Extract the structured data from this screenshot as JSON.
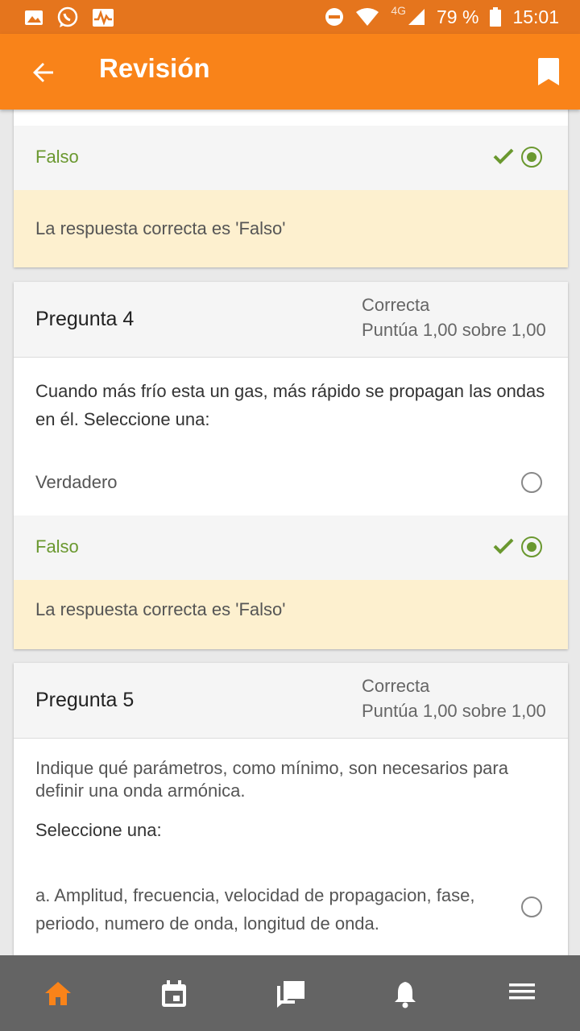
{
  "status_bar": {
    "network": "4G",
    "battery": "79 %",
    "time": "15:01",
    "left_icons": [
      "gallery-icon",
      "whatsapp-icon",
      "pulse-icon"
    ],
    "right_icons": [
      "do-not-disturb-icon",
      "wifi-icon",
      "signal-icon",
      "battery-icon"
    ]
  },
  "app_bar": {
    "title": "Revisión",
    "back_icon": "arrow-left-icon",
    "bookmark_icon": "bookmark-icon"
  },
  "question3_tail": {
    "selected_option": "Falso",
    "feedback": "La respuesta correcta es 'Falso'"
  },
  "question4": {
    "title": "Pregunta 4",
    "state": "Correcta",
    "grade": "Puntúa 1,00 sobre 1,00",
    "text": "Cuando más frío esta un gas, más rápido se propagan las ondas en él. Seleccione una:",
    "options": [
      {
        "label": "Verdadero",
        "checked": false
      },
      {
        "label": "Falso",
        "checked": true
      }
    ],
    "feedback": "La respuesta correcta es 'Falso'"
  },
  "question5": {
    "title": "Pregunta 5",
    "state": "Correcta",
    "grade": "Puntúa 1,00 sobre 1,00",
    "text": "Indique qué parámetros, como mínimo, son necesarios para definir una onda armónica.",
    "prompt": "Seleccione una:",
    "options": [
      {
        "label": "a. Amplitud, frecuencia, velocidad de propagacion, fase, periodo, numero de onda, longitud de onda.",
        "checked": false
      }
    ]
  },
  "bottom_nav": {
    "items": [
      "home-icon",
      "calendar-icon",
      "messages-icon",
      "notifications-icon",
      "menu-icon"
    ],
    "active_color": "#f98319",
    "inactive_color": "#ffffff"
  },
  "colors": {
    "accent": "#f98319",
    "correct": "#6a982f",
    "feedback_bg": "#fdf0cf"
  }
}
